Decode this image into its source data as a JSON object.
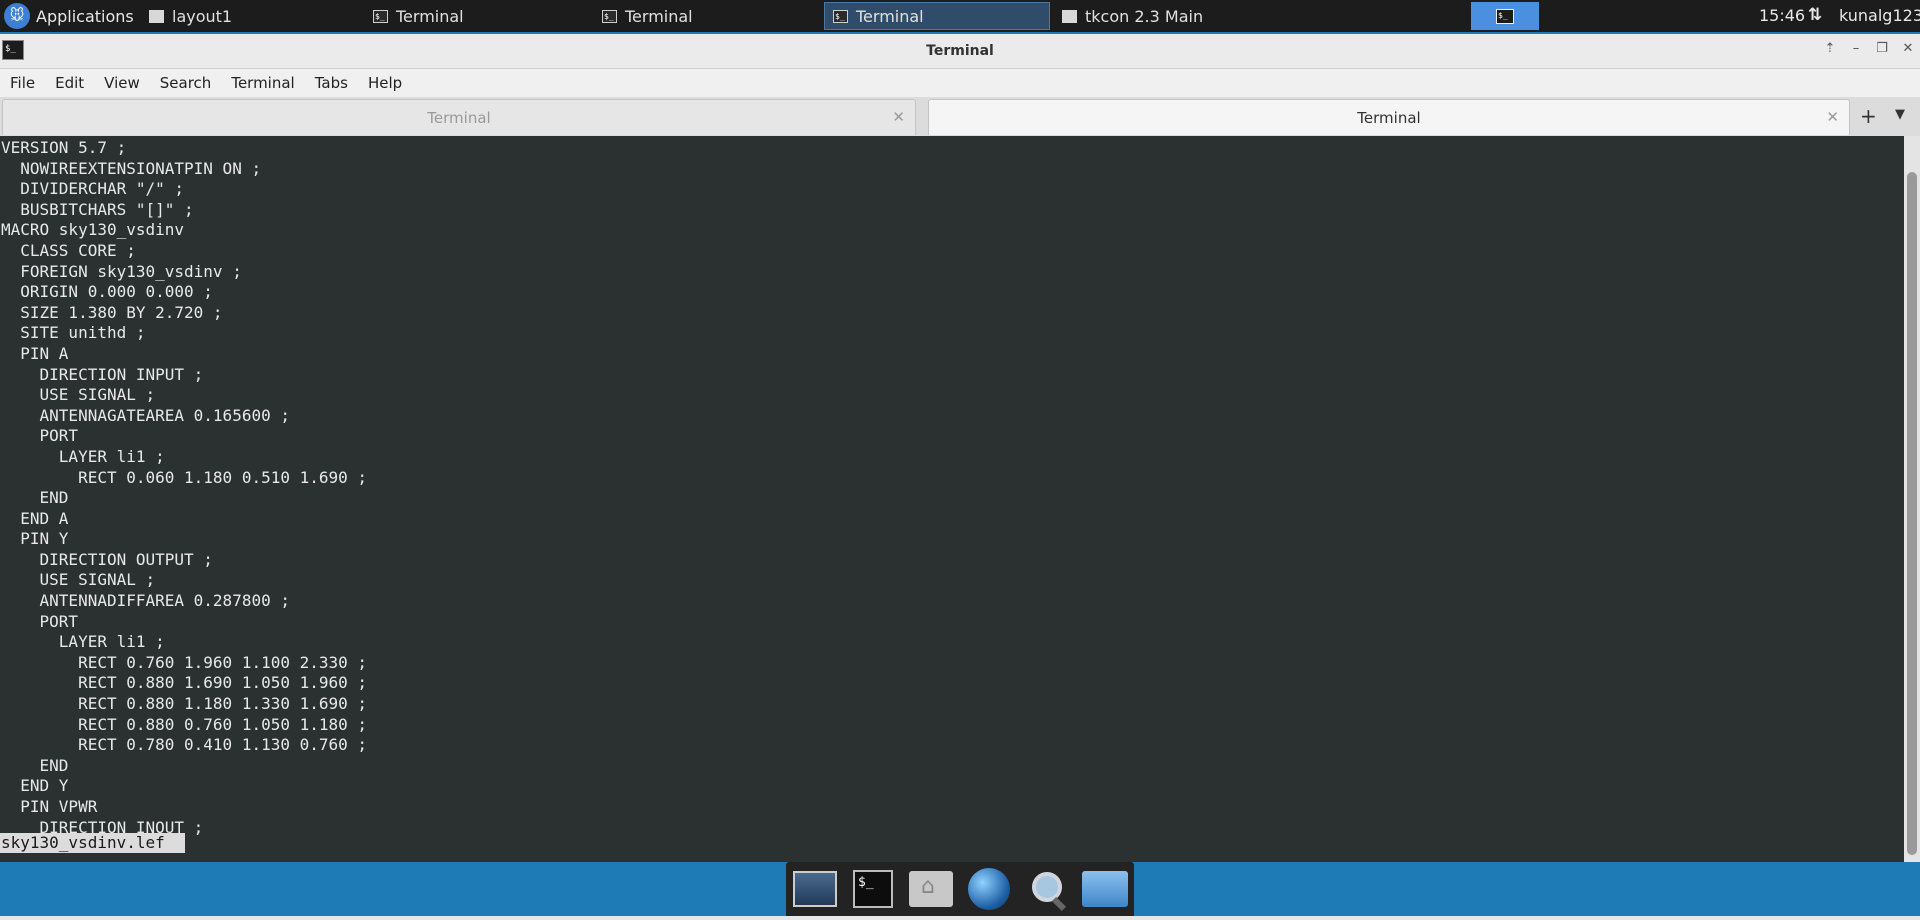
{
  "top_panel": {
    "applications_label": "Applications",
    "tasks": [
      {
        "label": "layout1",
        "icon": "window-icon"
      },
      {
        "label": "Terminal",
        "icon": "terminal-icon"
      },
      {
        "label": "Terminal",
        "icon": "terminal-icon"
      },
      {
        "label": "Terminal",
        "icon": "terminal-icon",
        "active": true
      },
      {
        "label": "tkcon 2.3 Main",
        "icon": "window-icon"
      }
    ],
    "clock": "15:46",
    "user": "kunalg123"
  },
  "window": {
    "title": "Terminal",
    "menu": [
      "File",
      "Edit",
      "View",
      "Search",
      "Terminal",
      "Tabs",
      "Help"
    ],
    "tabs": [
      {
        "label": "Terminal",
        "active": false
      },
      {
        "label": "Terminal",
        "active": true
      }
    ]
  },
  "terminal": {
    "lines": [
      "VERSION 5.7 ;",
      "  NOWIREEXTENSIONATPIN ON ;",
      "  DIVIDERCHAR \"/\" ;",
      "  BUSBITCHARS \"[]\" ;",
      "MACRO sky130_vsdinv",
      "  CLASS CORE ;",
      "  FOREIGN sky130_vsdinv ;",
      "  ORIGIN 0.000 0.000 ;",
      "  SIZE 1.380 BY 2.720 ;",
      "  SITE unithd ;",
      "  PIN A",
      "    DIRECTION INPUT ;",
      "    USE SIGNAL ;",
      "    ANTENNAGATEAREA 0.165600 ;",
      "    PORT",
      "      LAYER li1 ;",
      "        RECT 0.060 1.180 0.510 1.690 ;",
      "    END",
      "  END A",
      "  PIN Y",
      "    DIRECTION OUTPUT ;",
      "    USE SIGNAL ;",
      "    ANTENNADIFFAREA 0.287800 ;",
      "    PORT",
      "      LAYER li1 ;",
      "        RECT 0.760 1.960 1.100 2.330 ;",
      "        RECT 0.880 1.690 1.050 1.960 ;",
      "        RECT 0.880 1.180 1.330 1.690 ;",
      "        RECT 0.880 0.760 1.050 1.180 ;",
      "        RECT 0.780 0.410 1.130 0.760 ;",
      "    END",
      "  END Y",
      "  PIN VPWR",
      "    DIRECTION INOUT ;"
    ],
    "status_line": "sky130_vsdinv.lef"
  }
}
